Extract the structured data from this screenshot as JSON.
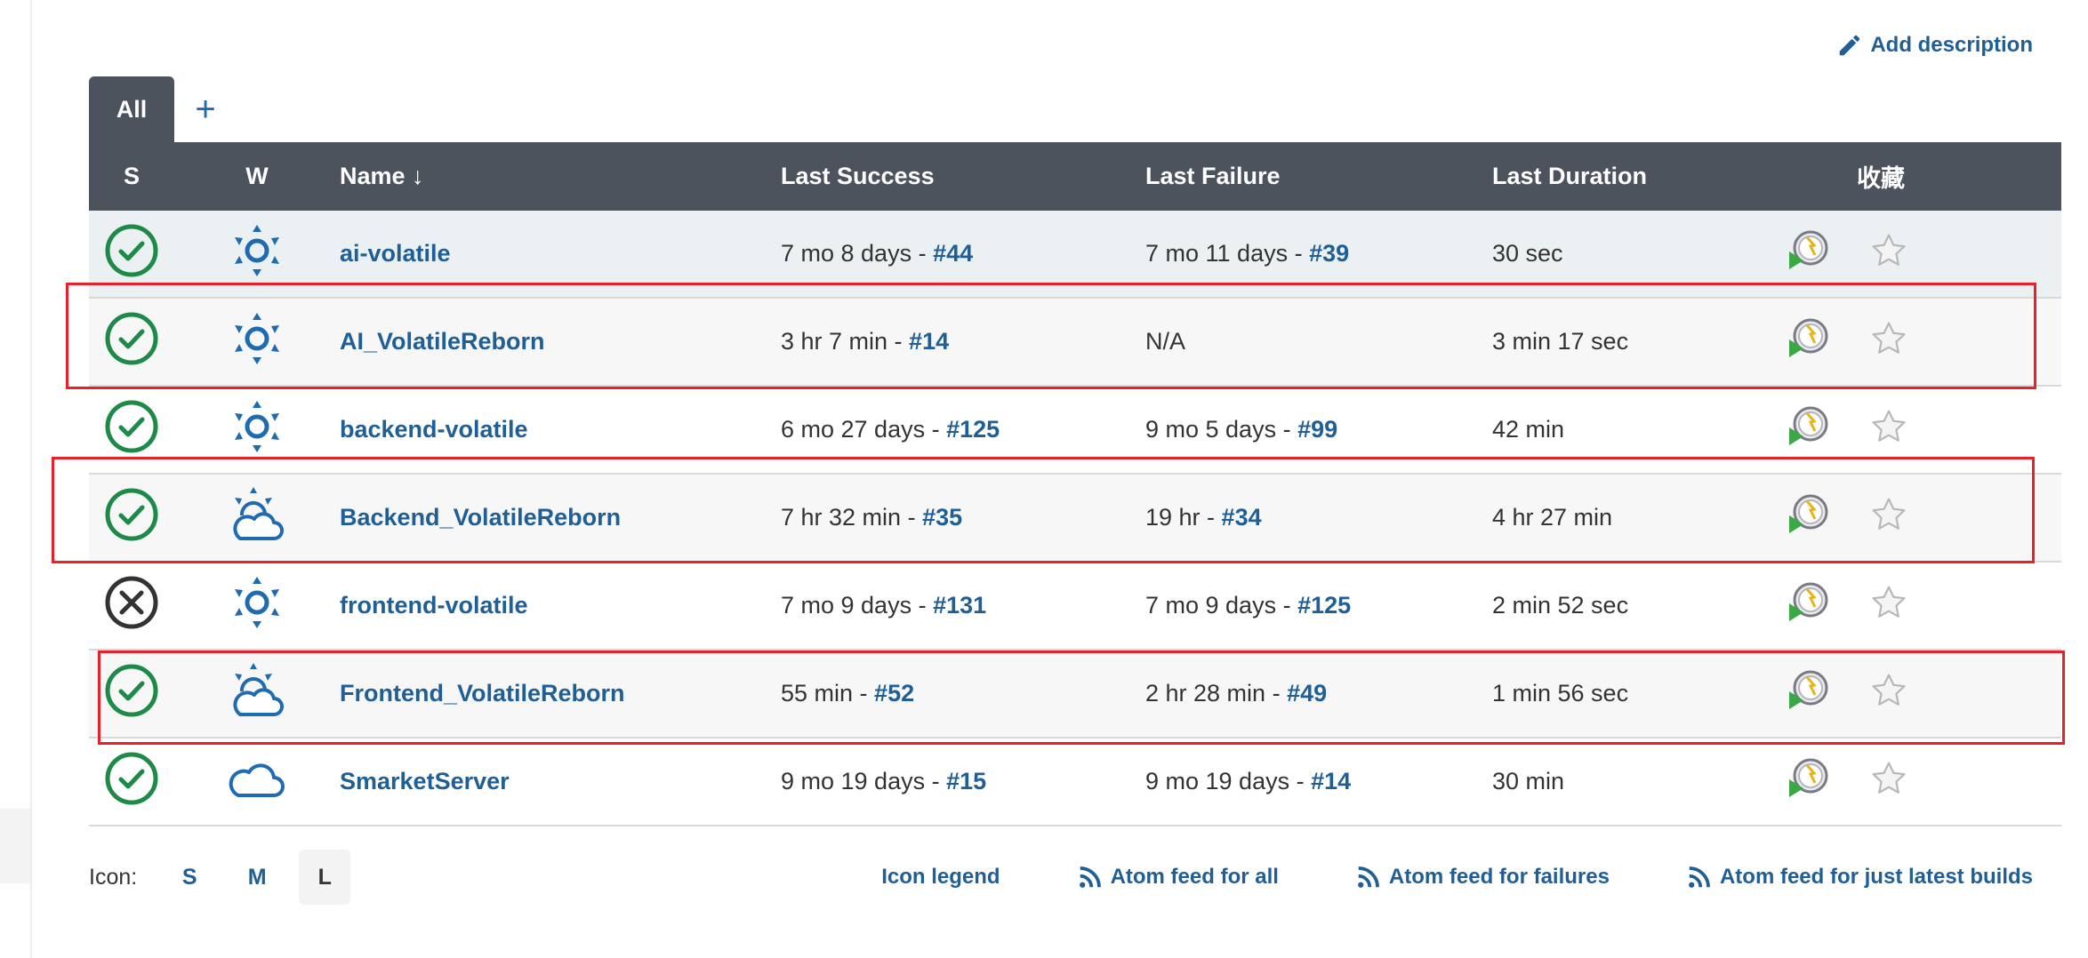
{
  "header": {
    "add_description": "Add description"
  },
  "tabs": {
    "all": "All",
    "add": "+"
  },
  "columns": {
    "s": "S",
    "w": "W",
    "name": "Name ↓",
    "last_success": "Last Success",
    "last_failure": "Last Failure",
    "last_duration": "Last Duration",
    "favorite": "收藏"
  },
  "jobs": [
    {
      "name": "ai-volatile",
      "status": "success",
      "weather": "sunny",
      "success_time": "7 mo 8 days - ",
      "success_build": "#44",
      "failure_time": "7 mo 11 days - ",
      "failure_build": "#39",
      "duration": "30 sec"
    },
    {
      "name": "AI_VolatileReborn",
      "status": "success",
      "weather": "sunny",
      "success_time": "3 hr 7 min - ",
      "success_build": "#14",
      "failure_time": "N/A",
      "failure_build": "",
      "duration": "3 min 17 sec"
    },
    {
      "name": "backend-volatile",
      "status": "success",
      "weather": "sunny",
      "success_time": "6 mo 27 days - ",
      "success_build": "#125",
      "failure_time": "9 mo 5 days - ",
      "failure_build": "#99",
      "duration": "42 min"
    },
    {
      "name": "Backend_VolatileReborn",
      "status": "success",
      "weather": "partly-cloudy",
      "success_time": "7 hr 32 min - ",
      "success_build": "#35",
      "failure_time": "19 hr - ",
      "failure_build": "#34",
      "duration": "4 hr 27 min"
    },
    {
      "name": "frontend-volatile",
      "status": "failed",
      "weather": "sunny",
      "success_time": "7 mo 9 days - ",
      "success_build": "#131",
      "failure_time": "7 mo 9 days - ",
      "failure_build": "#125",
      "duration": "2 min 52 sec"
    },
    {
      "name": "Frontend_VolatileReborn",
      "status": "success",
      "weather": "partly-cloudy",
      "success_time": "55 min - ",
      "success_build": "#52",
      "failure_time": "2 hr 28 min - ",
      "failure_build": "#49",
      "duration": "1 min 56 sec"
    },
    {
      "name": "SmarketServer",
      "status": "success",
      "weather": "cloudy",
      "success_time": "9 mo 19 days - ",
      "success_build": "#15",
      "failure_time": "9 mo 19 days - ",
      "failure_build": "#14",
      "duration": "30 min"
    }
  ],
  "footer": {
    "icon_label": "Icon:",
    "sizes": [
      "S",
      "M",
      "L"
    ],
    "active_size": "L",
    "icon_legend": "Icon legend",
    "feed_all": "Atom feed for all",
    "feed_failures": "Atom feed for failures",
    "feed_latest": "Atom feed for just latest builds"
  },
  "colors": {
    "accent": "#1f5f96",
    "header_bg": "#4c535c",
    "success": "#1e8a48",
    "failed": "#333333",
    "weather": "#1f6bb2",
    "highlight": "#e8202a"
  }
}
